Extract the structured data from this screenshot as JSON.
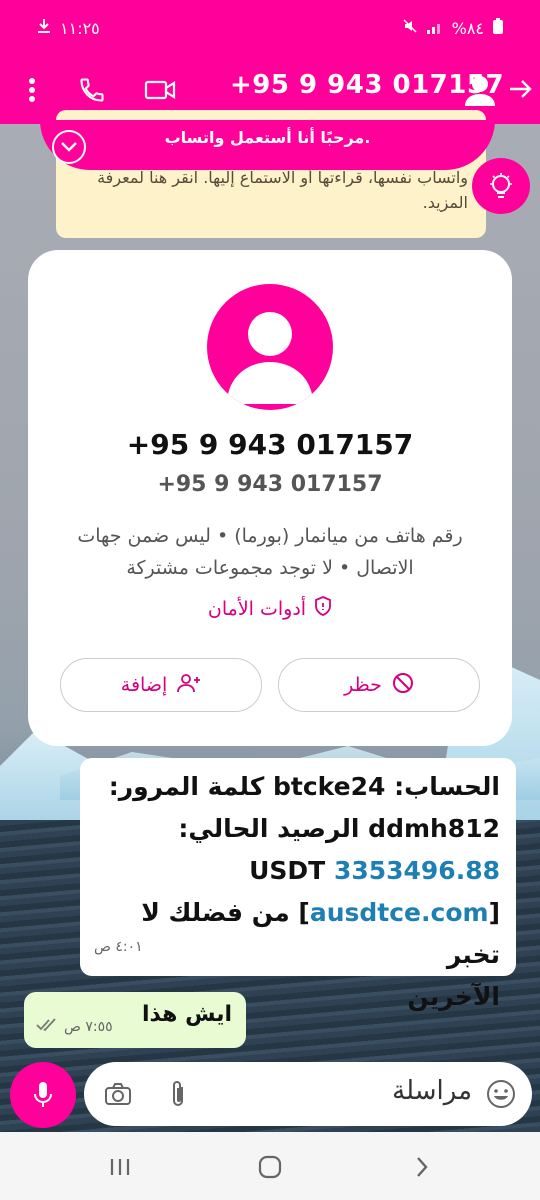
{
  "status": {
    "time": "١١:٢٥",
    "battery": "%٨٤"
  },
  "header": {
    "title": "+95 9 943 017157",
    "subtitle": "مرحبًا أنا أستعمل واتساب."
  },
  "notice": {
    "text": "بحيث لا يستطيع أحد خارج هذه الدردشة، ولا حتى شركة واتساب نفسها، قراءتها أو الاستماع إليها. انقر هنا لمعرفة المزيد."
  },
  "contact": {
    "name": "+95 9 943 017157",
    "phone": "+95 9 943 017157",
    "description": "رقم هاتف من ميانمار (بورما) • ليس ضمن جهات الاتصال • لا توجد مجموعات مشتركة",
    "safety_label": "أدوات الأمان",
    "block_label": "حظر",
    "add_label": "إضافة"
  },
  "messages": {
    "incoming": {
      "line1": "الحساب: btcke24 كلمة المرور:",
      "line2": "ddmh812 الرصيد الحالي:",
      "amount": "3353496.88",
      "currency": "USDT",
      "link": "ausdtce.com",
      "line4_after": " من فضلك لا تخبر",
      "line5": "الآخرين",
      "time": "٤:٠١ ص"
    },
    "outgoing": {
      "text": "ايش هذا",
      "time": "٧:٥٥ ص"
    }
  },
  "composer": {
    "placeholder": "مراسلة"
  },
  "colors": {
    "brand": "#ff009a",
    "link": "#1e7fb4",
    "outgoing_bubble": "#e8fbd3",
    "notice_bg": "#fdf2c9"
  }
}
